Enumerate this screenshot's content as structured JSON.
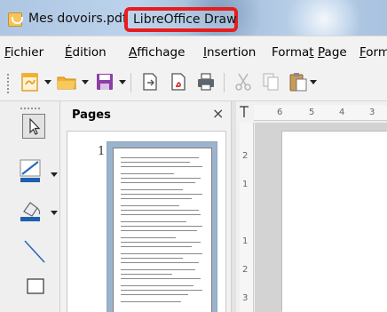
{
  "window": {
    "document_title": "Mes dovoirs.pdf",
    "app_name": "LibreOffice Draw"
  },
  "menubar": {
    "items": [
      {
        "label": "Fichier",
        "accel": "F"
      },
      {
        "label": "Édition",
        "accel": "É"
      },
      {
        "label": "Affichage",
        "accel": "A"
      },
      {
        "label": "Insertion",
        "accel": "I"
      },
      {
        "label": "Format",
        "accel": "t"
      },
      {
        "label": "Page",
        "accel": "P"
      },
      {
        "label": "Forme",
        "accel": "F"
      }
    ]
  },
  "toolbar": {
    "icons": [
      "new-document-icon",
      "open-folder-icon",
      "save-icon",
      "export-icon",
      "export-pdf-icon",
      "print-icon",
      "cut-icon",
      "copy-icon",
      "paste-icon"
    ]
  },
  "drawing_tools": {
    "icons": [
      "select-pointer-icon",
      "line-color-icon",
      "fill-color-icon",
      "line-tool-icon",
      "rectangle-tool-icon"
    ]
  },
  "pages_panel": {
    "title": "Pages",
    "close_symbol": "×",
    "page_number": "1"
  },
  "rulers": {
    "horizontal_labels": [
      "6",
      "5",
      "4",
      "3"
    ],
    "vertical_labels": [
      "2",
      "1",
      "1",
      "2",
      "3"
    ]
  },
  "colors": {
    "highlight_border": "#e81c1c",
    "thumbnail_selection": "#9cb3cc",
    "folder_yellow": "#f2b02d",
    "save_purple": "#8b3fa6"
  }
}
